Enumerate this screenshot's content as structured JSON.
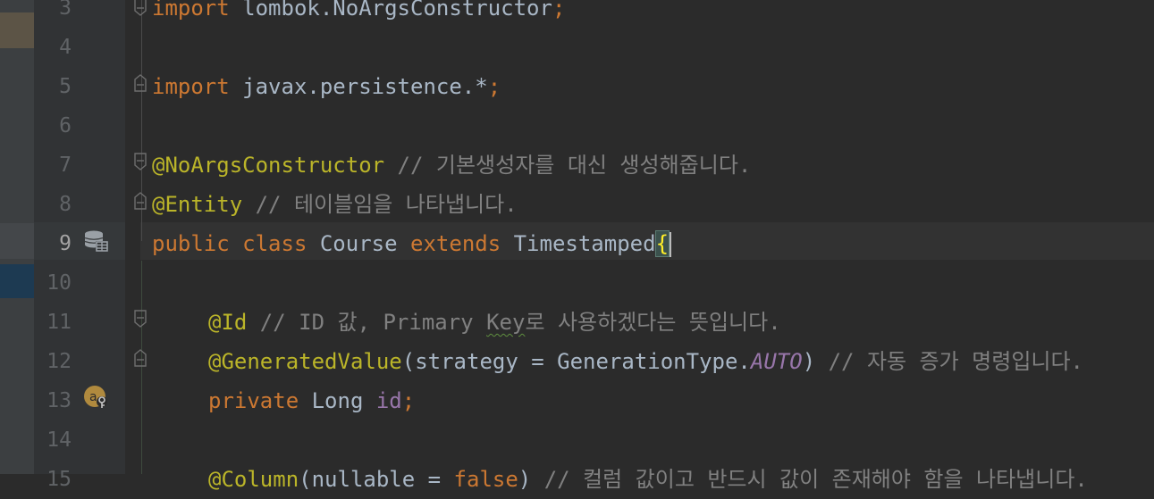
{
  "gutter": {
    "line_numbers": [
      "3",
      "4",
      "5",
      "6",
      "7",
      "8",
      "9",
      "10",
      "11",
      "12",
      "13",
      "14",
      "15"
    ]
  },
  "code": {
    "line3": {
      "import_kw": "import ",
      "path": "lombok.NoArgsConstructor",
      "semi": ";"
    },
    "line5": {
      "import_kw": "import ",
      "path": "javax.persistence.*",
      "semi": ";"
    },
    "line7": {
      "annotation": "@NoArgsConstructor",
      "comment": " // 기본생성자를 대신 생성해줍니다."
    },
    "line8": {
      "annotation": "@Entity",
      "comment": " // 테이블임을 나타냅니다."
    },
    "line9": {
      "public_kw": "public ",
      "class_kw": "class ",
      "class_name": "Course ",
      "extends_kw": "extends ",
      "parent": "Timestamped",
      "brace": "{"
    },
    "line11": {
      "annotation": "@Id",
      "comment_pre": " // ID 값, Primary ",
      "comment_typo": "Key",
      "comment_post": "로 사용하겠다는 뜻입니다."
    },
    "line12": {
      "annotation": "@GeneratedValue",
      "args_open": "(strategy = GenerationType.",
      "constant": "AUTO",
      "args_close": ")",
      "comment": " // 자동 증가 명령입니다."
    },
    "line13": {
      "private_kw": "private ",
      "type": "Long ",
      "field": "id",
      "semi": ";"
    },
    "line15": {
      "annotation": "@Column",
      "args_open": "(nullable = ",
      "false_kw": "false",
      "args_close": ")",
      "comment": " // 컬럼 값이고 반드시 값이 존재해야 함을 나타냅니다."
    }
  },
  "icons": {
    "line9": "database-table-icon",
    "line13": "autogenerated-id-icon"
  },
  "colors": {
    "editor_bg": "#2b2b2b",
    "keyword": "#cc7832",
    "annotation": "#bbb529",
    "comment": "#808080",
    "identifier": "#a9b7c6",
    "constant": "#9876aa"
  }
}
